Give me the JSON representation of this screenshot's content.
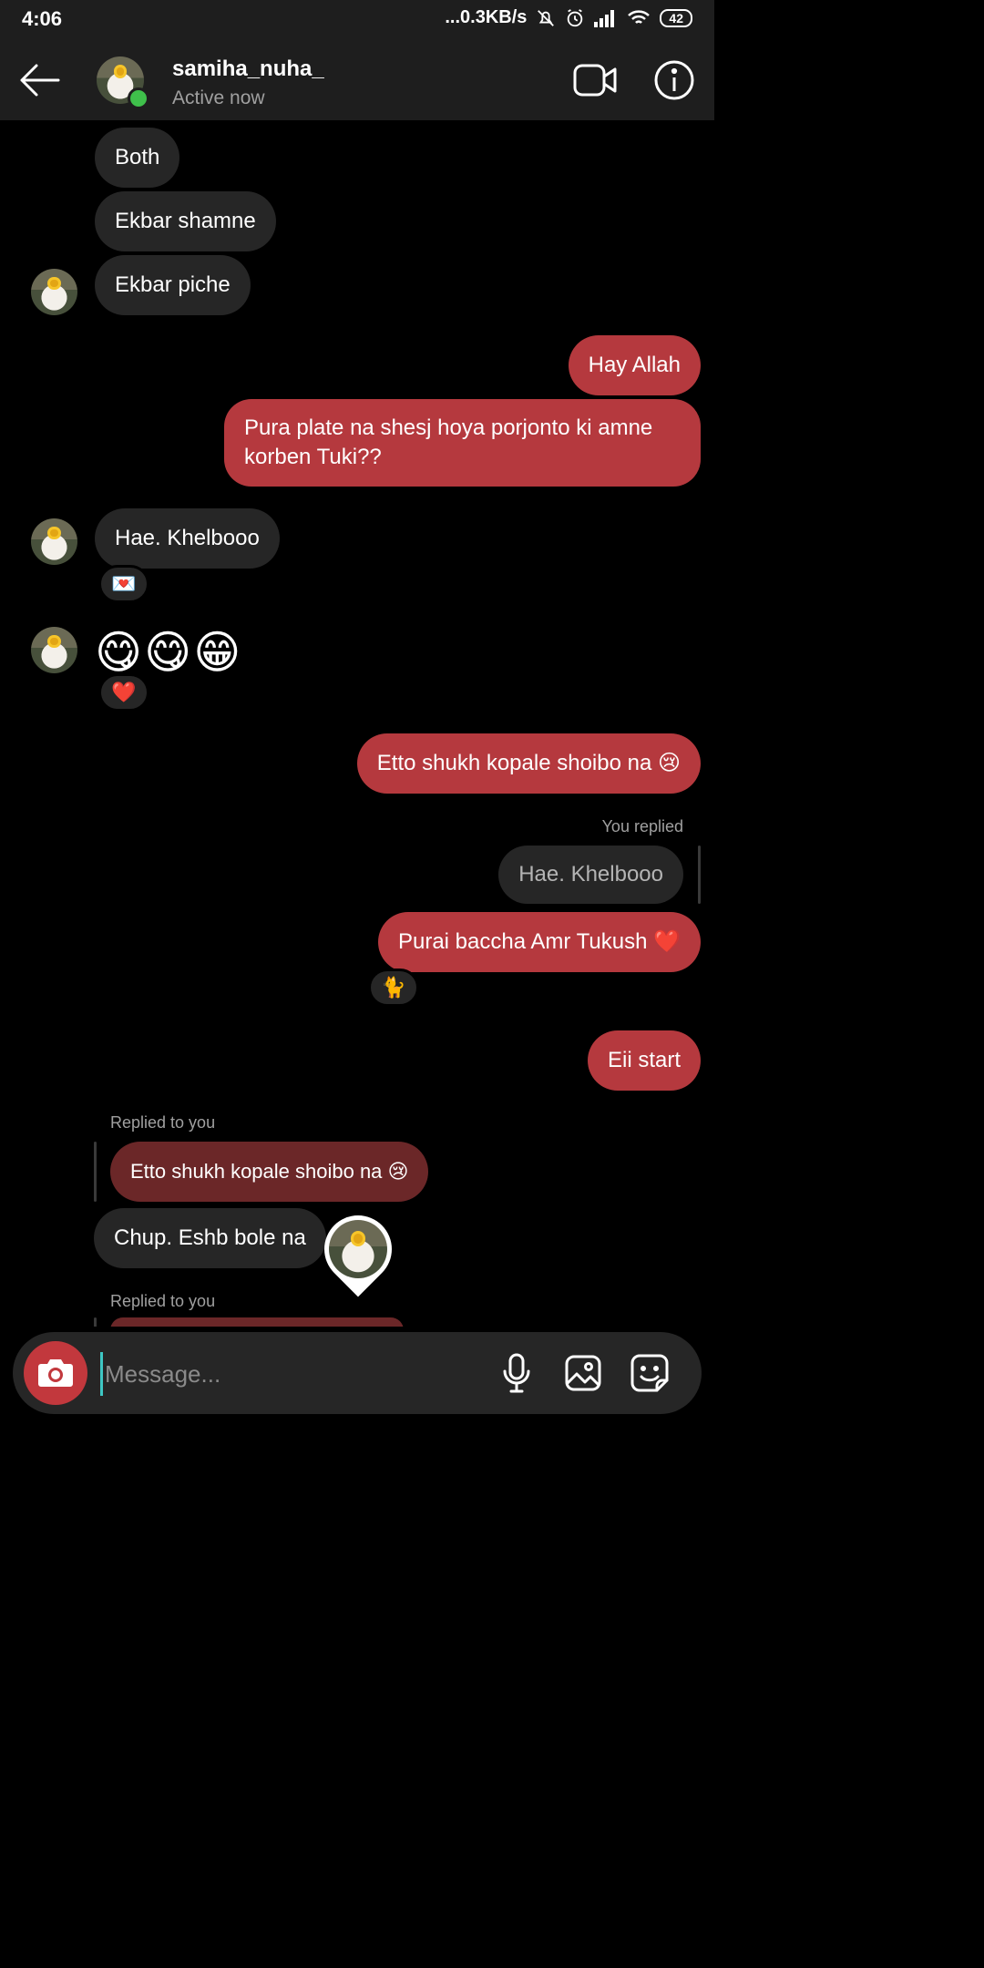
{
  "status_bar": {
    "time": "4:06",
    "network": "...0.3KB/s",
    "battery": "42"
  },
  "header": {
    "username": "samiha_nuha_",
    "status": "Active now"
  },
  "messages": {
    "in_both": "Both",
    "in_ekbar_shamne": "Ekbar shamne",
    "in_ekbar_piche": "Ekbar piche",
    "out_hay_allah": "Hay Allah",
    "out_pura_plate": "Pura plate na shesj hoya porjonto ki amne korben Tuki??",
    "in_hae_khelbooo": "Hae. Khelbooo",
    "react_envelope": "💌",
    "in_emojis": "😋😋😁",
    "react_heart": "❤️",
    "out_etto_shukh": "Etto shukh kopale shoibo na 😢",
    "you_replied_label": "You replied",
    "replied_quote": "Hae. Khelbooo",
    "out_purai_baccha": "Purai baccha Amr Tukush ❤️",
    "react_cat": "🐈",
    "out_eii_start": "Eii start",
    "replied_to_you_label": "Replied to you",
    "quote_etto_shukh": "Etto shukh kopale shoibo na 😢",
    "in_chup": "Chup. Eshb bole na",
    "replied_to_you_label_2": "Replied to you"
  },
  "composer": {
    "placeholder": "Message..."
  }
}
